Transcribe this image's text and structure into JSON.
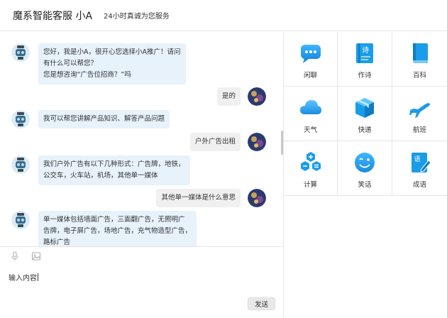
{
  "header": {
    "title": "魔系智能客服 小A",
    "subtitle": "24小时真诚为您服务"
  },
  "messages": [
    {
      "from": "bot",
      "lines": [
        "您好，我是小A，很开心您选择小A推广！请问",
        "有什么可以帮您？",
        "您是想咨询“广告位招商？”吗"
      ]
    },
    {
      "from": "user",
      "lines": [
        "是的"
      ]
    },
    {
      "from": "bot",
      "lines": [
        "我可以帮您讲解产品知识、解答产品问题"
      ]
    },
    {
      "from": "user",
      "lines": [
        "户外广告出租"
      ]
    },
    {
      "from": "bot",
      "lines": [
        "我们户外广告有以下几种形式：广告牌，地铁，",
        "公交车，火车站，机场，其他单一媒体"
      ]
    },
    {
      "from": "user",
      "lines": [
        "其他单一媒体是什么意思"
      ]
    },
    {
      "from": "bot",
      "lines": [
        "单一媒体包括墙面广告，三面翻广告，无照明广",
        "告牌，电子屏广告，场地广告，充气物造型广告，",
        "路标广告"
      ]
    }
  ],
  "toolbar": {
    "voice_icon": "microphone-icon",
    "image_icon": "image-icon"
  },
  "input": {
    "value": "输入内容"
  },
  "send": {
    "label": "发送"
  },
  "services": [
    {
      "label": "闲聊",
      "icon": "chat-bubble-icon"
    },
    {
      "label": "作诗",
      "icon": "poem-icon"
    },
    {
      "label": "百科",
      "icon": "book-icon"
    },
    {
      "label": "天气",
      "icon": "cloud-icon"
    },
    {
      "label": "快递",
      "icon": "package-icon"
    },
    {
      "label": "航班",
      "icon": "airplane-icon"
    },
    {
      "label": "计算",
      "icon": "calculator-icon"
    },
    {
      "label": "笑话",
      "icon": "smile-icon"
    },
    {
      "label": "成语",
      "icon": "idiom-icon"
    }
  ],
  "colors": {
    "accent": "#1a9ce8",
    "bot_bubble": "#e7f2fb",
    "user_bubble": "#f0f0f0"
  }
}
